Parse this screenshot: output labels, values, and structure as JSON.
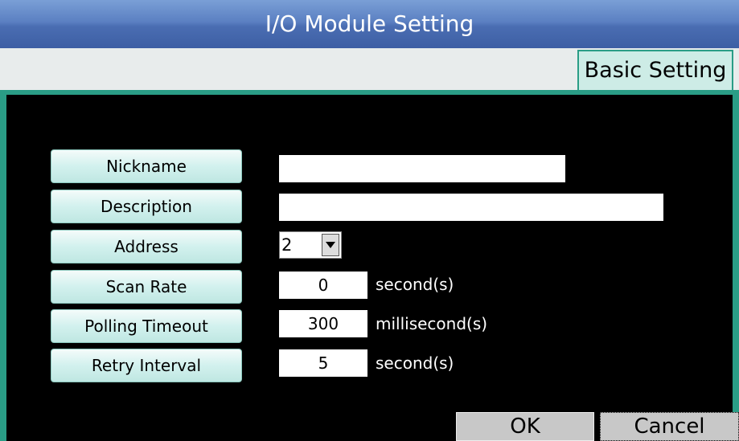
{
  "window": {
    "title": "I/O Module Setting"
  },
  "tabs": [
    {
      "label": "Basic Setting",
      "active": true
    }
  ],
  "form": {
    "nickname": {
      "label": "Nickname",
      "value": ""
    },
    "description": {
      "label": "Description",
      "value": ""
    },
    "address": {
      "label": "Address",
      "value": "2"
    },
    "scan_rate": {
      "label": "Scan Rate",
      "value": "0",
      "unit": "second(s)"
    },
    "polling_timeout": {
      "label": "Polling Timeout",
      "value": "300",
      "unit": "millisecond(s)"
    },
    "retry_interval": {
      "label": "Retry Interval",
      "value": "5",
      "unit": "second(s)"
    }
  },
  "buttons": {
    "ok": "OK",
    "cancel": "Cancel"
  },
  "colors": {
    "accent": "#2a9d86",
    "title_bar": "#4a6db2",
    "label_bg": "#d2f1ee"
  },
  "icons": {
    "dropdown": "chevron-down-icon"
  }
}
